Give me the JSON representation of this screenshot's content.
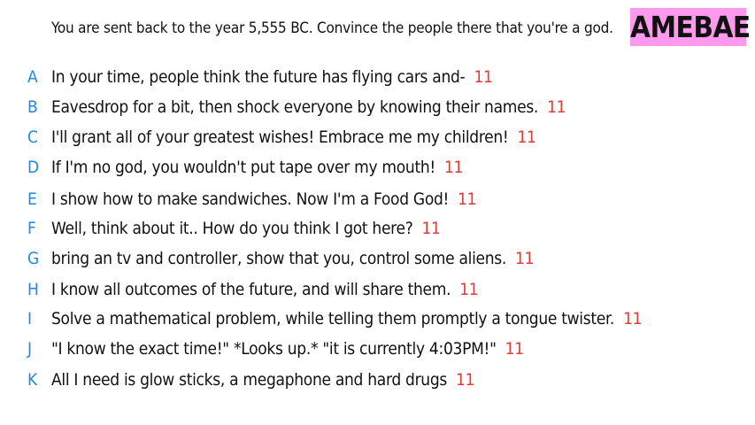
{
  "prompt": "You are sent back to the year 5,555 BC. Convince the people there that you're a god.",
  "logo": "AMEBAE",
  "colors": {
    "letter": "#1e88e5",
    "votes": "#e53935",
    "logo_bg": "#ff99ee"
  },
  "answers": [
    {
      "letter": "A",
      "text": "In your time, people think the future has flying cars and-",
      "votes": "11"
    },
    {
      "letter": "B",
      "text": "Eavesdrop for a bit, then shock everyone by knowing their names.",
      "votes": "11"
    },
    {
      "letter": "C",
      "text": "I'll grant all of your greatest wishes! Embrace me my children!",
      "votes": "11"
    },
    {
      "letter": "D",
      "text": "If I'm no god, you wouldn't put tape over my mouth!",
      "votes": "11"
    },
    {
      "letter": "E",
      "text": "I show how to make sandwiches. Now I'm a Food God!",
      "votes": "11"
    },
    {
      "letter": "F",
      "text": "Well, think about it.. How do you think I got here?",
      "votes": "11"
    },
    {
      "letter": "G",
      "text": "bring an tv and controller, show that you, control some aliens.",
      "votes": "11"
    },
    {
      "letter": "H",
      "text": "I know all outcomes of the future, and will share them.",
      "votes": "11"
    },
    {
      "letter": "I",
      "text": "Solve a mathematical problem, while telling them promptly a tongue twister.",
      "votes": "11"
    },
    {
      "letter": "J",
      "text": "\"I know the exact time!\" *Looks up.* \"it is currently 4:03PM!\"",
      "votes": "11"
    },
    {
      "letter": "K",
      "text": "All I need is glow sticks, a megaphone and hard drugs",
      "votes": "11"
    }
  ]
}
